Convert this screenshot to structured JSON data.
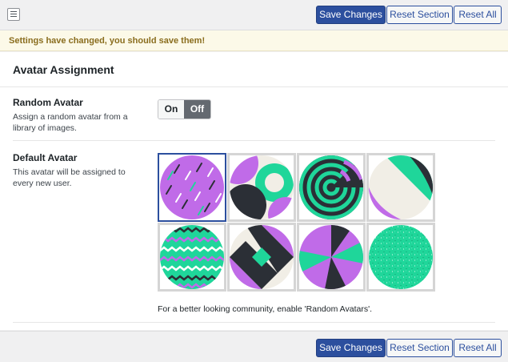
{
  "toolbar": {
    "menu_icon": "list-menu-icon",
    "save_label": "Save Changes",
    "reset_section_label": "Reset Section",
    "reset_all_label": "Reset All"
  },
  "notice": {
    "text": "Settings have changed, you should save them!"
  },
  "section": {
    "title": "Avatar Assignment"
  },
  "random_avatar": {
    "label": "Random Avatar",
    "description": "Assign a random avatar from a library of images.",
    "on_label": "On",
    "off_label": "Off",
    "value": "Off"
  },
  "default_avatar": {
    "label": "Default Avatar",
    "description": "This avatar will be assigned to every new user.",
    "selected_index": 0,
    "avatars": [
      {
        "name": "dashes-purple"
      },
      {
        "name": "arcs-green-black"
      },
      {
        "name": "concentric-rings"
      },
      {
        "name": "diagonal-band"
      },
      {
        "name": "zigzag-stripes"
      },
      {
        "name": "diamond-chevron"
      },
      {
        "name": "pinwheel"
      },
      {
        "name": "speckled-green"
      }
    ],
    "hint": "For a better looking community, enable 'Random Avatars'."
  },
  "colors": {
    "primary": "#2c4f9e",
    "purple": "#c06be8",
    "green": "#1fd69a",
    "dark": "#2b2f36",
    "cream": "#f1eee6"
  }
}
